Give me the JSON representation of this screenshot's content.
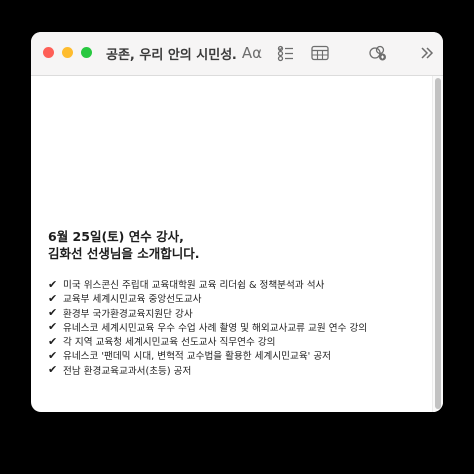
{
  "window": {
    "title": "공존, 우리 안의 시민성…"
  },
  "toolbar": {
    "font_button_label": "Aα",
    "icons": [
      "format-text-icon",
      "checklist-icon",
      "table-icon",
      "share-icon",
      "more-chevron-icon"
    ]
  },
  "note": {
    "heading_line1": "6월 25일(토) 연수 강사,",
    "heading_line2": "김화선 선생님을 소개합니다.",
    "check_mark": "✔",
    "items": [
      "미국 위스콘신 주립대 교육대학원 교육 리더쉽 & 정책분석과 석사",
      "교육부 세계시민교육 중앙선도교사",
      "환경부 국가환경교육지원단 강사",
      "유네스코 세계시민교육 우수 수업 사례 촬영 및 해외교사교류 교원 연수 강의",
      "각 지역 교육청 세계시민교육 선도교사 직무연수 강의",
      "유네스코 '팬데믹 시대, 변혁적 교수법을 활용한 세계시민교육' 공저",
      "전남 환경교육교과서(초등) 공저"
    ]
  },
  "colors": {
    "close": "#fe5f57",
    "minimize": "#febc2e",
    "zoom": "#28c840",
    "toolbar_bg": "#f6f5f5",
    "text": "#1d1d1d"
  }
}
